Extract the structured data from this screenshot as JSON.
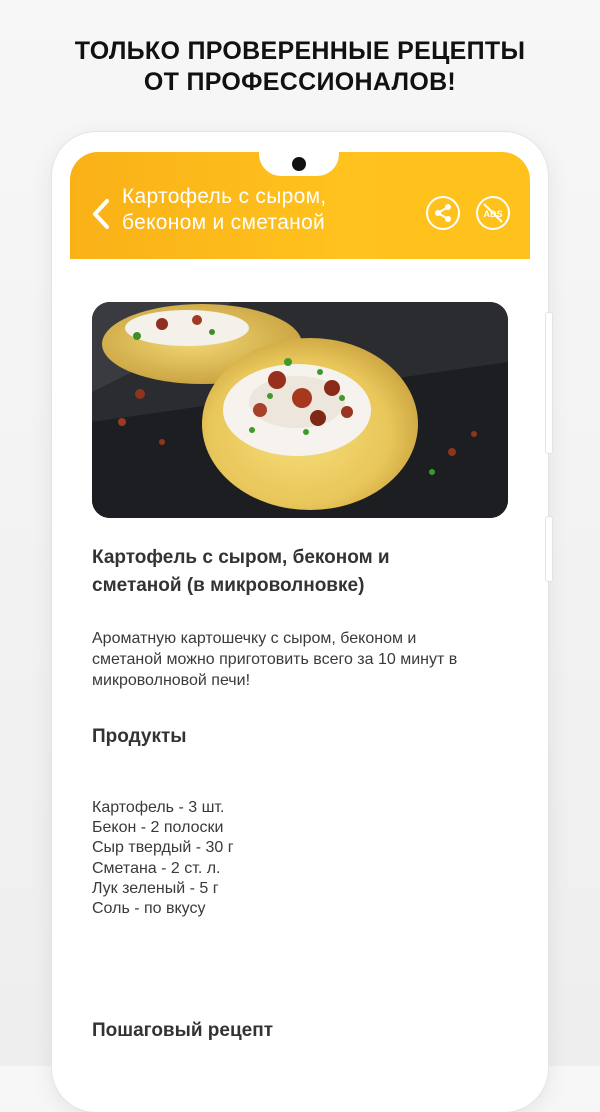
{
  "promo": {
    "line1": "ТОЛЬКО ПРОВЕРЕННЫЕ РЕЦЕПТЫ",
    "line2": "ОТ ПРОФЕССИОНАЛОВ!"
  },
  "appbar": {
    "title_line1": "Картофель с сыром,",
    "title_line2": "беконом и сметаной",
    "back_icon": "chevron-left-icon",
    "share_icon": "share-icon",
    "noads_icon": "no-ads-icon",
    "noads_label": "ADS",
    "accent_color": "#ffc11b"
  },
  "recipe": {
    "title_line1": "Картофель с сыром, беконом и",
    "title_line2": "сметаной (в микроволновке)",
    "desc_line1": "Ароматную картошечку с сыром, беконом и",
    "desc_line2": "сметаной можно приготовить всего за 10 минут в",
    "desc_line3": "микроволновой печи!",
    "products_heading": "Продукты",
    "ingredients": [
      "Картофель - 3 шт.",
      "Бекон - 2 полоски",
      "Сыр твердый - 30 г",
      "Сметана - 2 ст. л.",
      "Лук зеленый - 5 г",
      "Соль - по вкусу"
    ],
    "steps_heading": "Пошаговый рецепт"
  }
}
